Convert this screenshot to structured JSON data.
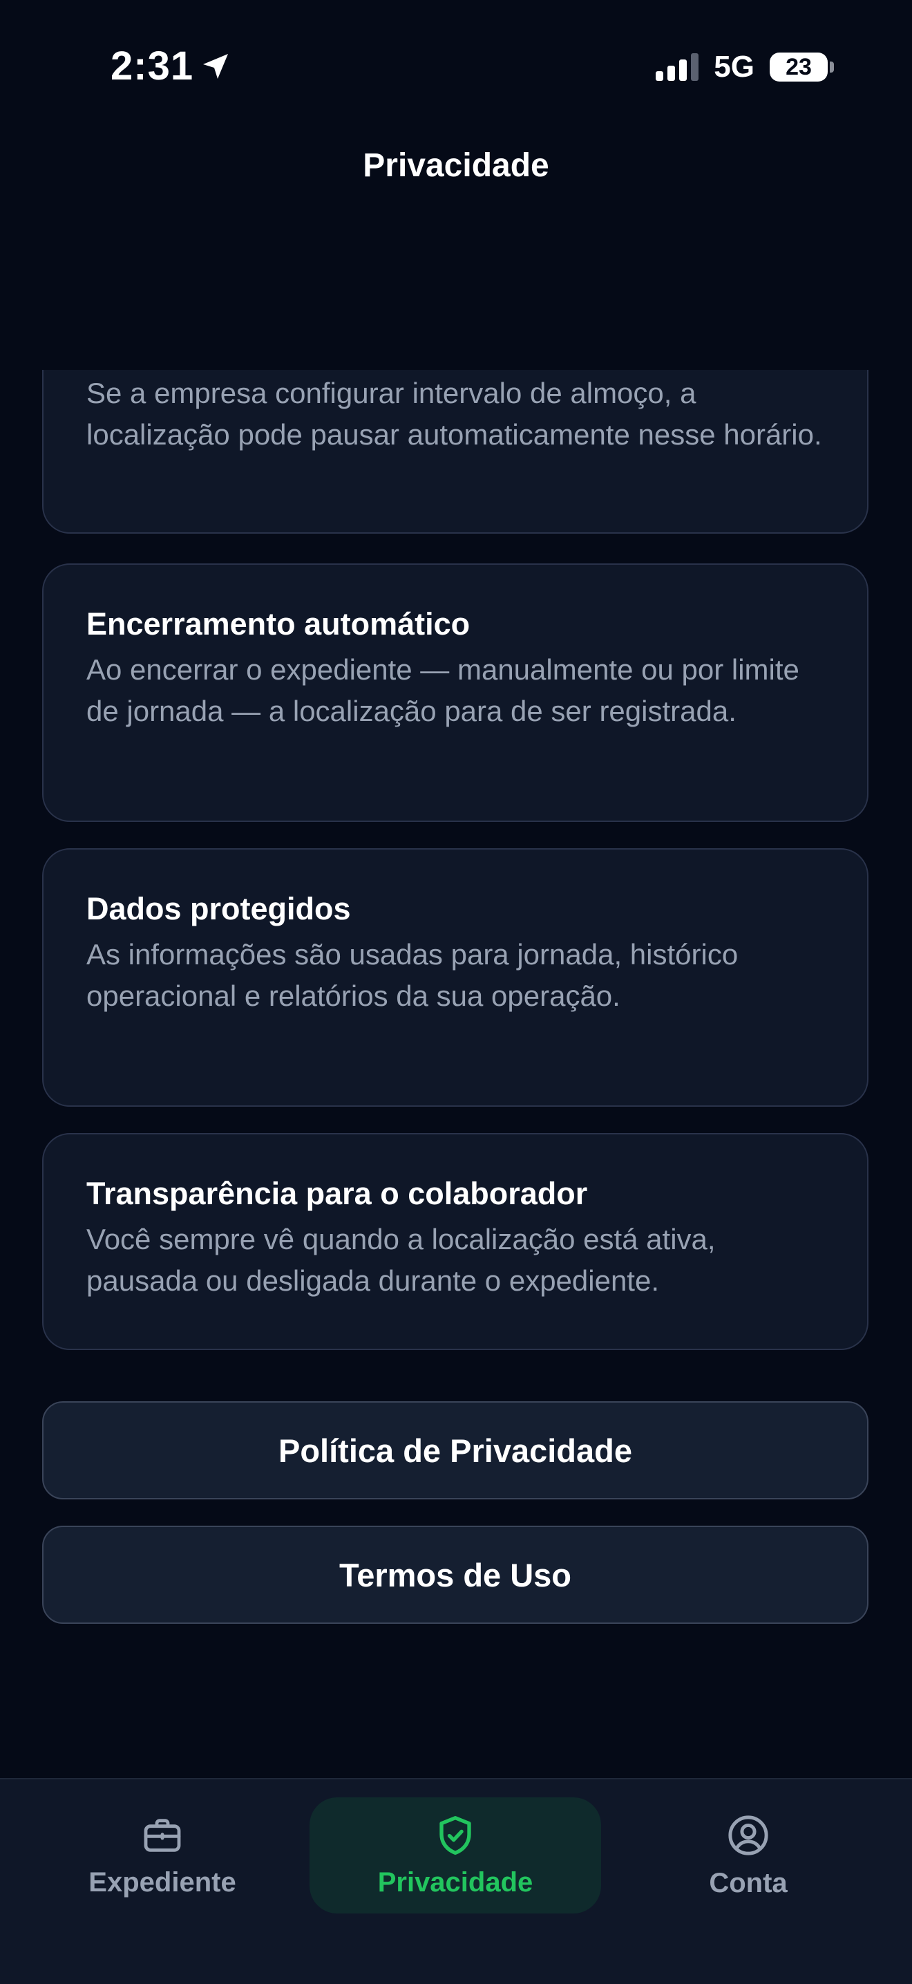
{
  "status_bar": {
    "time": "2:31",
    "network": "5G",
    "battery": "23"
  },
  "header": {
    "title": "Privacidade"
  },
  "cards": [
    {
      "title": "",
      "text": "Se a empresa configurar intervalo de almoço, a localização pode pausar automaticamente nesse horário."
    },
    {
      "title": "Encerramento automático",
      "text": "Ao encerrar o expediente — manualmente ou por limite de jornada — a localização para de ser registrada."
    },
    {
      "title": "Dados protegidos",
      "text": "As informações são usadas para jornada, histórico operacional e relatórios da sua operação."
    },
    {
      "title": "Transparência para o colaborador",
      "text": "Você sempre vê quando a localização está ativa, pausada ou desligada durante o expediente."
    }
  ],
  "links": {
    "privacy_policy": "Política de Privacidade",
    "terms": "Termos de Uso"
  },
  "tab_bar": {
    "items": [
      {
        "label": "Expediente",
        "icon": "briefcase-icon",
        "active": false
      },
      {
        "label": "Privacidade",
        "icon": "shield-check-icon",
        "active": true
      },
      {
        "label": "Conta",
        "icon": "user-circle-icon",
        "active": false
      }
    ]
  },
  "colors": {
    "background": "#050a17",
    "card": "#0f1728",
    "accent": "#22c55e",
    "muted_text": "#98a2b3"
  }
}
